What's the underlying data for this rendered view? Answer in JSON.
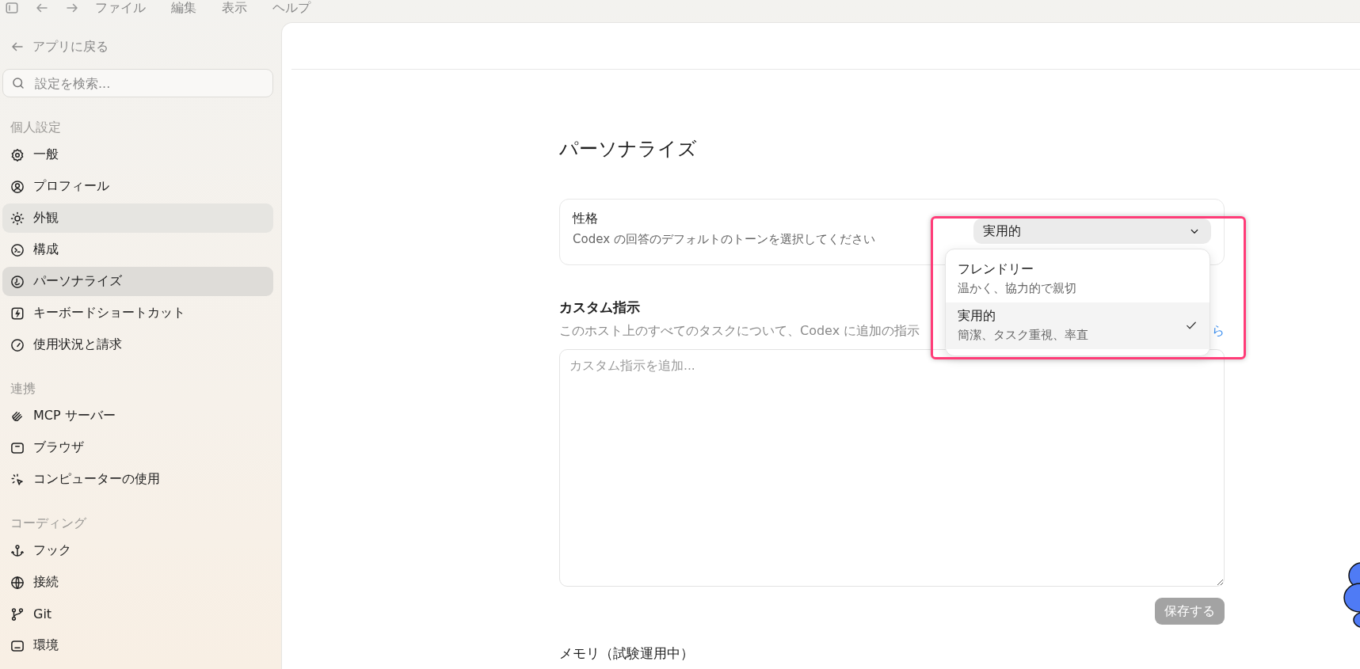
{
  "menubar": {
    "items": [
      "ファイル",
      "編集",
      "表示",
      "ヘルプ"
    ]
  },
  "sidebar": {
    "back": "アプリに戻る",
    "search": {
      "placeholder": "設定を検索..."
    },
    "sections": [
      {
        "title": "個人設定",
        "items": [
          {
            "label": "一般",
            "selected": false,
            "hovered": false
          },
          {
            "label": "プロフィール",
            "selected": false,
            "hovered": false
          },
          {
            "label": "外観",
            "selected": false,
            "hovered": true
          },
          {
            "label": "構成",
            "selected": false,
            "hovered": false
          },
          {
            "label": "パーソナライズ",
            "selected": true,
            "hovered": false
          },
          {
            "label": "キーボードショートカット",
            "selected": false,
            "hovered": false
          },
          {
            "label": "使用状況と請求",
            "selected": false,
            "hovered": false
          }
        ]
      },
      {
        "title": "連携",
        "items": [
          {
            "label": "MCP サーバー",
            "selected": false,
            "hovered": false
          },
          {
            "label": "ブラウザ",
            "selected": false,
            "hovered": false
          },
          {
            "label": "コンピューターの使用",
            "selected": false,
            "hovered": false
          }
        ]
      },
      {
        "title": "コーディング",
        "items": [
          {
            "label": "フック",
            "selected": false,
            "hovered": false
          },
          {
            "label": "接続",
            "selected": false,
            "hovered": false
          },
          {
            "label": "Git",
            "selected": false,
            "hovered": false
          },
          {
            "label": "環境",
            "selected": false,
            "hovered": false
          }
        ]
      }
    ]
  },
  "page": {
    "title": "パーソナライズ",
    "personality": {
      "label": "性格",
      "description": "Codex の回答のデフォルトのトーンを選択してください",
      "value": "実用的",
      "expanded": true,
      "options": [
        {
          "label": "フレンドリー",
          "description": "温かく、協力的で親切",
          "selected": false
        },
        {
          "label": "実用的",
          "description": "簡潔、タスク重視、率直",
          "selected": true
        }
      ]
    },
    "custom": {
      "title": "カスタム指示",
      "description": "このホスト上のすべてのタスクについて、Codex に追加の指示",
      "link": "ら",
      "placeholder": "カスタム指示を追加...",
      "save": {
        "label": "保存する",
        "disabled": true
      }
    },
    "memory": {
      "title": "メモリ（試験運用中）"
    }
  }
}
